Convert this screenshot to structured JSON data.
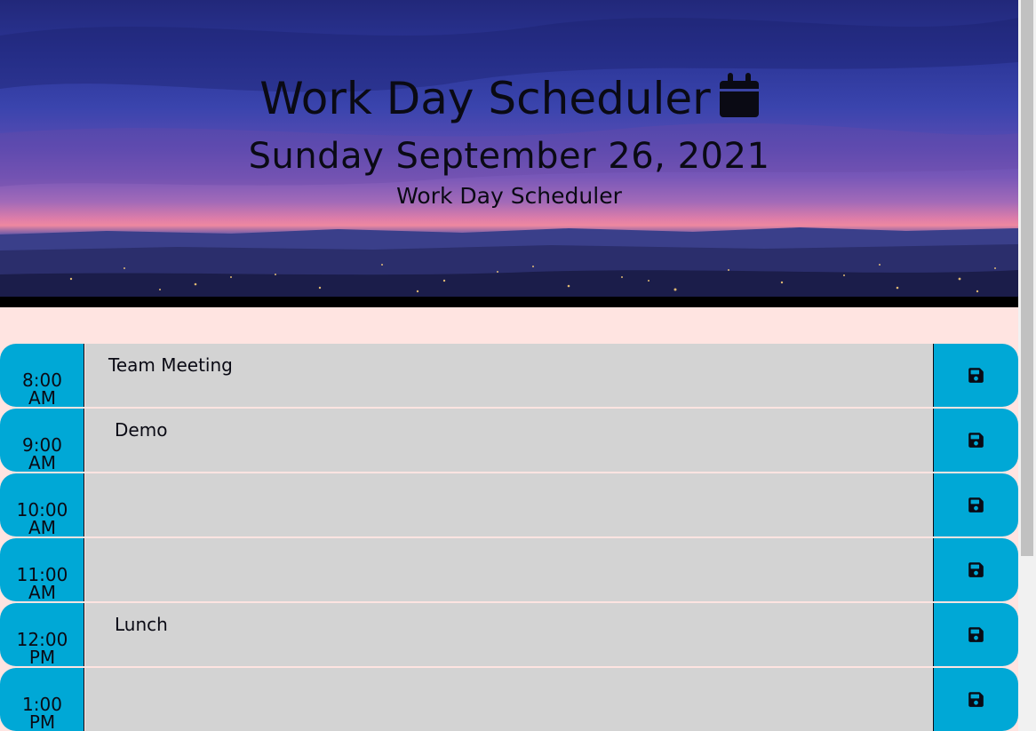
{
  "header": {
    "title": "Work Day Scheduler",
    "date": "Sunday September 26, 2021",
    "subtitle": "Work Day Scheduler"
  },
  "colors": {
    "hour_bg": "#00a8d6",
    "event_bg": "#d3d3d3",
    "page_bg": "#ffe4e1"
  },
  "schedule": [
    {
      "time": "8:00",
      "ampm": "AM",
      "event": "Team Meeting"
    },
    {
      "time": "9:00",
      "ampm": "AM",
      "event": "Demo"
    },
    {
      "time": "10:00",
      "ampm": "AM",
      "event": ""
    },
    {
      "time": "11:00",
      "ampm": "AM",
      "event": ""
    },
    {
      "time": "12:00",
      "ampm": "PM",
      "event": "Lunch"
    },
    {
      "time": "1:00",
      "ampm": "PM",
      "event": ""
    }
  ],
  "icons": {
    "title_icon": "calendar-icon",
    "save_icon": "floppy-disk-icon"
  }
}
